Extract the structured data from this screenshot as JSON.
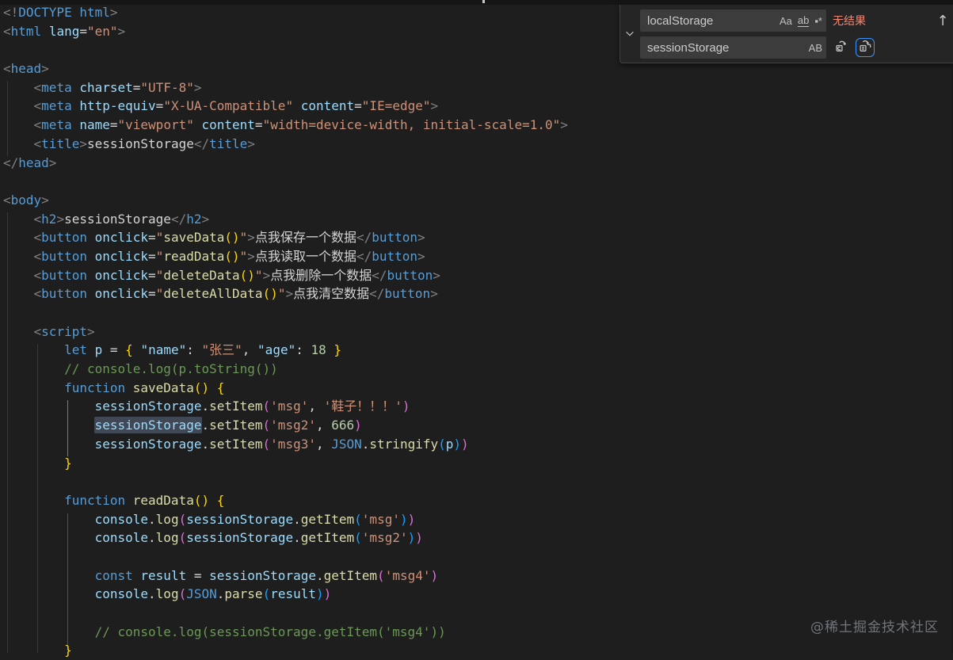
{
  "colors": {
    "editor_bg": "#1e1e1e",
    "widget_bg": "#252526",
    "input_bg": "#3c3c3c",
    "no_results": "#f48771",
    "focus_outline": "#3794ff",
    "tag": "#569cd6",
    "attr": "#9cdcfe",
    "string": "#ce9178",
    "function": "#dcdcaa",
    "number": "#b5cea8",
    "comment": "#6a9955",
    "bracket1": "#ffd700",
    "bracket2": "#da70d6",
    "bracket3": "#179fff"
  },
  "find_widget": {
    "find_value": "localStorage",
    "replace_value": "sessionStorage",
    "results_label": "无结果",
    "toggles": {
      "match_case": "Aa",
      "whole_word": "ab",
      "regex": "▪*",
      "preserve_case": "AB"
    },
    "icons": {
      "previous_match": "↑",
      "chevron": "chevron-down",
      "replace_one": "replace-icon",
      "replace_all": "replace-all-icon"
    }
  },
  "watermark": "@稀土掘金技术社区",
  "editor": {
    "lines": [
      [
        [
          "punct",
          "<!"
        ],
        [
          "tag",
          "DOCTYPE"
        ],
        [
          "txt",
          " "
        ],
        [
          "tag",
          "html"
        ],
        [
          "punct",
          ">"
        ]
      ],
      [
        [
          "punct",
          "<"
        ],
        [
          "tag",
          "html"
        ],
        [
          "txt",
          " "
        ],
        [
          "attr",
          "lang"
        ],
        [
          "txt",
          "="
        ],
        [
          "str",
          "\"en\""
        ],
        [
          "punct",
          ">"
        ]
      ],
      [],
      [
        [
          "punct",
          "<"
        ],
        [
          "tag",
          "head"
        ],
        [
          "punct",
          ">"
        ]
      ],
      [
        [
          "txt",
          "    "
        ],
        [
          "punct",
          "<"
        ],
        [
          "tag",
          "meta"
        ],
        [
          "txt",
          " "
        ],
        [
          "attr",
          "charset"
        ],
        [
          "txt",
          "="
        ],
        [
          "str",
          "\"UTF-8\""
        ],
        [
          "punct",
          ">"
        ]
      ],
      [
        [
          "txt",
          "    "
        ],
        [
          "punct",
          "<"
        ],
        [
          "tag",
          "meta"
        ],
        [
          "txt",
          " "
        ],
        [
          "attr",
          "http-equiv"
        ],
        [
          "txt",
          "="
        ],
        [
          "str",
          "\"X-UA-Compatible\""
        ],
        [
          "txt",
          " "
        ],
        [
          "attr",
          "content"
        ],
        [
          "txt",
          "="
        ],
        [
          "str",
          "\"IE=edge\""
        ],
        [
          "punct",
          ">"
        ]
      ],
      [
        [
          "txt",
          "    "
        ],
        [
          "punct",
          "<"
        ],
        [
          "tag",
          "meta"
        ],
        [
          "txt",
          " "
        ],
        [
          "attr",
          "name"
        ],
        [
          "txt",
          "="
        ],
        [
          "str",
          "\"viewport\""
        ],
        [
          "txt",
          " "
        ],
        [
          "attr",
          "content"
        ],
        [
          "txt",
          "="
        ],
        [
          "str",
          "\"width=device-width, initial-scale=1.0\""
        ],
        [
          "punct",
          ">"
        ]
      ],
      [
        [
          "txt",
          "    "
        ],
        [
          "punct",
          "<"
        ],
        [
          "tag",
          "title"
        ],
        [
          "punct",
          ">"
        ],
        [
          "txt",
          "sessionStorage"
        ],
        [
          "punct",
          "</"
        ],
        [
          "tag",
          "title"
        ],
        [
          "punct",
          ">"
        ]
      ],
      [
        [
          "punct",
          "</"
        ],
        [
          "tag",
          "head"
        ],
        [
          "punct",
          ">"
        ]
      ],
      [],
      [
        [
          "punct",
          "<"
        ],
        [
          "tag",
          "body"
        ],
        [
          "punct",
          ">"
        ]
      ],
      [
        [
          "txt",
          "    "
        ],
        [
          "punct",
          "<"
        ],
        [
          "tag",
          "h2"
        ],
        [
          "punct",
          ">"
        ],
        [
          "txt",
          "sessionStorage"
        ],
        [
          "punct",
          "</"
        ],
        [
          "tag",
          "h2"
        ],
        [
          "punct",
          ">"
        ]
      ],
      [
        [
          "txt",
          "    "
        ],
        [
          "punct",
          "<"
        ],
        [
          "tag",
          "button"
        ],
        [
          "txt",
          " "
        ],
        [
          "attr",
          "onclick"
        ],
        [
          "txt",
          "="
        ],
        [
          "str",
          "\""
        ],
        [
          "fn",
          "saveData"
        ],
        [
          "b1",
          "()"
        ],
        [
          "str",
          "\""
        ],
        [
          "punct",
          ">"
        ],
        [
          "txt",
          "点我保存一个数据"
        ],
        [
          "punct",
          "</"
        ],
        [
          "tag",
          "button"
        ],
        [
          "punct",
          ">"
        ]
      ],
      [
        [
          "txt",
          "    "
        ],
        [
          "punct",
          "<"
        ],
        [
          "tag",
          "button"
        ],
        [
          "txt",
          " "
        ],
        [
          "attr",
          "onclick"
        ],
        [
          "txt",
          "="
        ],
        [
          "str",
          "\""
        ],
        [
          "fn",
          "readData"
        ],
        [
          "b1",
          "()"
        ],
        [
          "str",
          "\""
        ],
        [
          "punct",
          ">"
        ],
        [
          "txt",
          "点我读取一个数据"
        ],
        [
          "punct",
          "</"
        ],
        [
          "tag",
          "button"
        ],
        [
          "punct",
          ">"
        ]
      ],
      [
        [
          "txt",
          "    "
        ],
        [
          "punct",
          "<"
        ],
        [
          "tag",
          "button"
        ],
        [
          "txt",
          " "
        ],
        [
          "attr",
          "onclick"
        ],
        [
          "txt",
          "="
        ],
        [
          "str",
          "\""
        ],
        [
          "fn",
          "deleteData"
        ],
        [
          "b1",
          "()"
        ],
        [
          "str",
          "\""
        ],
        [
          "punct",
          ">"
        ],
        [
          "txt",
          "点我删除一个数据"
        ],
        [
          "punct",
          "</"
        ],
        [
          "tag",
          "button"
        ],
        [
          "punct",
          ">"
        ]
      ],
      [
        [
          "txt",
          "    "
        ],
        [
          "punct",
          "<"
        ],
        [
          "tag",
          "button"
        ],
        [
          "txt",
          " "
        ],
        [
          "attr",
          "onclick"
        ],
        [
          "txt",
          "="
        ],
        [
          "str",
          "\""
        ],
        [
          "fn",
          "deleteAllData"
        ],
        [
          "b1",
          "()"
        ],
        [
          "str",
          "\""
        ],
        [
          "punct",
          ">"
        ],
        [
          "txt",
          "点我清空数据"
        ],
        [
          "punct",
          "</"
        ],
        [
          "tag",
          "button"
        ],
        [
          "punct",
          ">"
        ]
      ],
      [],
      [
        [
          "txt",
          "    "
        ],
        [
          "punct",
          "<"
        ],
        [
          "tag",
          "script"
        ],
        [
          "punct",
          ">"
        ]
      ],
      [
        [
          "txt",
          "        "
        ],
        [
          "kw",
          "let"
        ],
        [
          "txt",
          " "
        ],
        [
          "var",
          "p"
        ],
        [
          "txt",
          " = "
        ],
        [
          "b1",
          "{"
        ],
        [
          "txt",
          " "
        ],
        [
          "attr",
          "\"name\""
        ],
        [
          "txt",
          ": "
        ],
        [
          "str",
          "\"张三\""
        ],
        [
          "txt",
          ", "
        ],
        [
          "attr",
          "\"age\""
        ],
        [
          "txt",
          ": "
        ],
        [
          "num",
          "18"
        ],
        [
          "txt",
          " "
        ],
        [
          "b1",
          "}"
        ]
      ],
      [
        [
          "txt",
          "        "
        ],
        [
          "cmt",
          "// console.log(p.toString())"
        ]
      ],
      [
        [
          "txt",
          "        "
        ],
        [
          "kw",
          "function"
        ],
        [
          "txt",
          " "
        ],
        [
          "fn",
          "saveData"
        ],
        [
          "b1",
          "()"
        ],
        [
          "txt",
          " "
        ],
        [
          "b1",
          "{"
        ]
      ],
      [
        [
          "txt",
          "            "
        ],
        [
          "var",
          "sessionStorage"
        ],
        [
          "txt",
          "."
        ],
        [
          "fn",
          "setItem"
        ],
        [
          "b2",
          "("
        ],
        [
          "str",
          "'msg'"
        ],
        [
          "txt",
          ", "
        ],
        [
          "str",
          "'鞋子！！！'"
        ],
        [
          "b2",
          ")"
        ]
      ],
      [
        [
          "txt",
          "            "
        ],
        [
          "varhl",
          "sessionStorage"
        ],
        [
          "txt",
          "."
        ],
        [
          "fn",
          "setItem"
        ],
        [
          "b2",
          "("
        ],
        [
          "str",
          "'msg2'"
        ],
        [
          "txt",
          ", "
        ],
        [
          "num",
          "666"
        ],
        [
          "b2",
          ")"
        ]
      ],
      [
        [
          "txt",
          "            "
        ],
        [
          "var",
          "sessionStorage"
        ],
        [
          "txt",
          "."
        ],
        [
          "fn",
          "setItem"
        ],
        [
          "b2",
          "("
        ],
        [
          "str",
          "'msg3'"
        ],
        [
          "txt",
          ", "
        ],
        [
          "kw",
          "JSON"
        ],
        [
          "txt",
          "."
        ],
        [
          "fn",
          "stringify"
        ],
        [
          "b3",
          "("
        ],
        [
          "var",
          "p"
        ],
        [
          "b3",
          ")"
        ],
        [
          "b2",
          ")"
        ]
      ],
      [
        [
          "txt",
          "        "
        ],
        [
          "b1",
          "}"
        ]
      ],
      [],
      [
        [
          "txt",
          "        "
        ],
        [
          "kw",
          "function"
        ],
        [
          "txt",
          " "
        ],
        [
          "fn",
          "readData"
        ],
        [
          "b1",
          "()"
        ],
        [
          "txt",
          " "
        ],
        [
          "b1",
          "{"
        ]
      ],
      [
        [
          "txt",
          "            "
        ],
        [
          "var",
          "console"
        ],
        [
          "txt",
          "."
        ],
        [
          "fn",
          "log"
        ],
        [
          "b2",
          "("
        ],
        [
          "var",
          "sessionStorage"
        ],
        [
          "txt",
          "."
        ],
        [
          "fn",
          "getItem"
        ],
        [
          "b3",
          "("
        ],
        [
          "str",
          "'msg'"
        ],
        [
          "b3",
          ")"
        ],
        [
          "b2",
          ")"
        ]
      ],
      [
        [
          "txt",
          "            "
        ],
        [
          "var",
          "console"
        ],
        [
          "txt",
          "."
        ],
        [
          "fn",
          "log"
        ],
        [
          "b2",
          "("
        ],
        [
          "var",
          "sessionStorage"
        ],
        [
          "txt",
          "."
        ],
        [
          "fn",
          "getItem"
        ],
        [
          "b3",
          "("
        ],
        [
          "str",
          "'msg2'"
        ],
        [
          "b3",
          ")"
        ],
        [
          "b2",
          ")"
        ]
      ],
      [],
      [
        [
          "txt",
          "            "
        ],
        [
          "kw",
          "const"
        ],
        [
          "txt",
          " "
        ],
        [
          "var",
          "result"
        ],
        [
          "txt",
          " = "
        ],
        [
          "var",
          "sessionStorage"
        ],
        [
          "txt",
          "."
        ],
        [
          "fn",
          "getItem"
        ],
        [
          "b2",
          "("
        ],
        [
          "str",
          "'msg4'"
        ],
        [
          "b2",
          ")"
        ]
      ],
      [
        [
          "txt",
          "            "
        ],
        [
          "var",
          "console"
        ],
        [
          "txt",
          "."
        ],
        [
          "fn",
          "log"
        ],
        [
          "b2",
          "("
        ],
        [
          "kw",
          "JSON"
        ],
        [
          "txt",
          "."
        ],
        [
          "fn",
          "parse"
        ],
        [
          "b3",
          "("
        ],
        [
          "var",
          "result"
        ],
        [
          "b3",
          ")"
        ],
        [
          "b2",
          ")"
        ]
      ],
      [],
      [
        [
          "txt",
          "            "
        ],
        [
          "cmt",
          "// console.log(sessionStorage.getItem('msg4'))"
        ]
      ],
      [
        [
          "txt",
          "        "
        ],
        [
          "b1",
          "}"
        ]
      ]
    ]
  }
}
